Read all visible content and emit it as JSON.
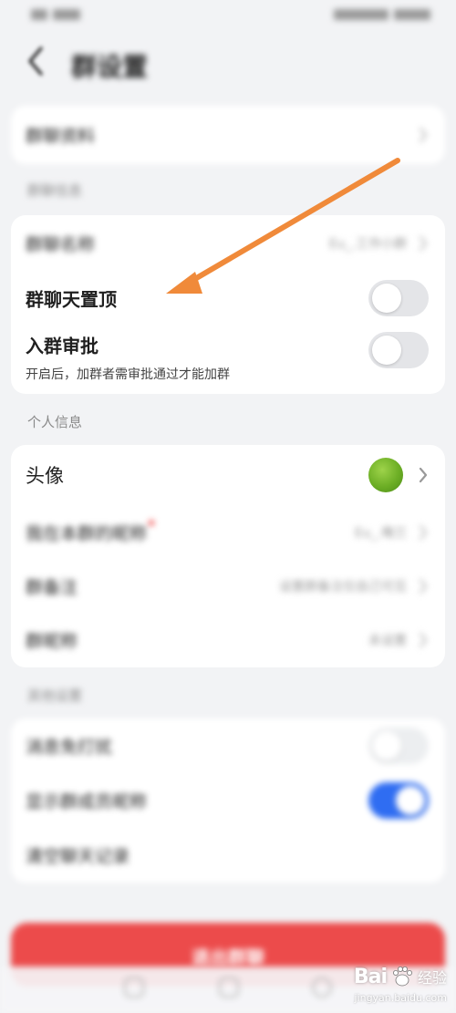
{
  "header": {
    "title": "群设置"
  },
  "card1": {
    "row_label": "群聊资料"
  },
  "section_group": {
    "title": "群聊信息"
  },
  "card2": {
    "group_name_label": "群聊名称",
    "group_name_value": "Eu_.工作小群",
    "pin_label": "群聊天置顶",
    "pin_on": false,
    "approval_label": "入群审批",
    "approval_sub": "开启后，加群者需审批通过才能加群",
    "approval_on": false
  },
  "section_personal": {
    "title": "个人信息"
  },
  "card3": {
    "avatar_label": "头像",
    "nickname_label": "我在本群的昵称",
    "nickname_value": "Eu_.俺兰",
    "remark_label": "群备注",
    "remark_value": "设置群备注仅自己可见",
    "mute_label": "群昵称",
    "mute_value": "未设置"
  },
  "section_other": {
    "title": "其他设置"
  },
  "card4": {
    "row1_label": "消息免打扰",
    "row1_on": false,
    "row2_label": "显示群成员昵称",
    "row2_on": true,
    "row3_label": "清空聊天记录"
  },
  "exit_button": {
    "label": "退出群聊"
  },
  "watermark": {
    "brand": "Bai",
    "brand2": "du",
    "cn": "经验",
    "url": "jingyan.baidu.com"
  },
  "colors": {
    "accent": "#2f6df2",
    "danger": "#ec4b4b",
    "arrow": "#f08a3a",
    "background": "#f2f3f5"
  },
  "icons": {
    "back": "chevron-left-icon",
    "row_chevron": "chevron-right-icon",
    "annotation": "arrow-icon"
  }
}
